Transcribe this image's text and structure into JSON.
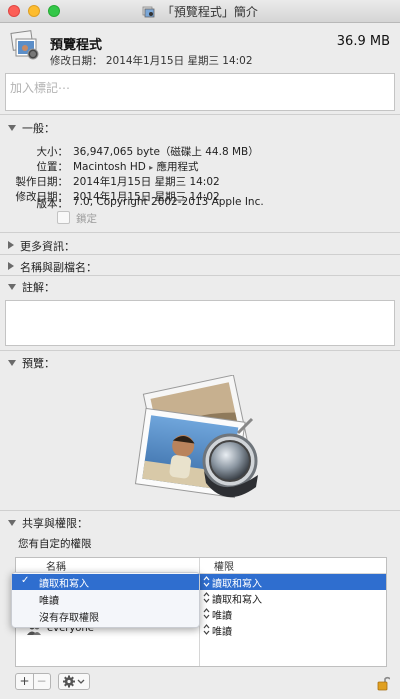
{
  "window": {
    "title": "「預覽程式」簡介"
  },
  "header": {
    "app_name": "預覽程式",
    "app_size": "36.9 MB",
    "modified": "修改日期：  2014年1月15日 星期三 14:02"
  },
  "tags": {
    "placeholder": "加入標記⋯"
  },
  "general": {
    "title": "一般：",
    "rows": [
      {
        "label": "大小：",
        "value": "36,947,065 byte（磁碟上 44.8 MB）"
      },
      {
        "label": "位置：",
        "value_a": "Macintosh HD",
        "value_b": "應用程式"
      },
      {
        "label": "製作日期：",
        "value": "2014年1月15日 星期三 14:02"
      },
      {
        "label": "修改日期：",
        "value": "2014年1月15日 星期三 14:02"
      },
      {
        "label": "版本：",
        "value": "7.0, Copyright 2002-2013 Apple Inc."
      }
    ],
    "locked_label": "鎖定"
  },
  "more_info": {
    "title": "更多資訊："
  },
  "name_ext": {
    "title": "名稱與副檔名："
  },
  "comments": {
    "title": "註解："
  },
  "preview": {
    "title": "預覽："
  },
  "sharing": {
    "title": "共享與權限：",
    "note": "您有自定的權限",
    "col_name": "名稱",
    "col_priv": "權限",
    "rows": [
      {
        "name": "",
        "priv": "讀取和寫入",
        "selected": true
      },
      {
        "name": "",
        "priv": "讀取和寫入",
        "selected": false
      },
      {
        "name": "",
        "priv": "唯讀",
        "selected": false
      },
      {
        "name": "everyone",
        "priv": "唯讀",
        "selected": false
      }
    ],
    "menu": {
      "items": [
        {
          "label": "讀取和寫入",
          "checked": true,
          "highlighted": true
        },
        {
          "label": "唯讀",
          "checked": false,
          "highlighted": false
        },
        {
          "label": "沒有存取權限",
          "checked": false,
          "highlighted": false
        }
      ],
      "check_glyph": "✓"
    }
  },
  "bottom": {
    "plus": "+",
    "minus": "−"
  },
  "colors": {
    "selection": "#2f6ecf",
    "accent_lock": "#e0a020"
  }
}
